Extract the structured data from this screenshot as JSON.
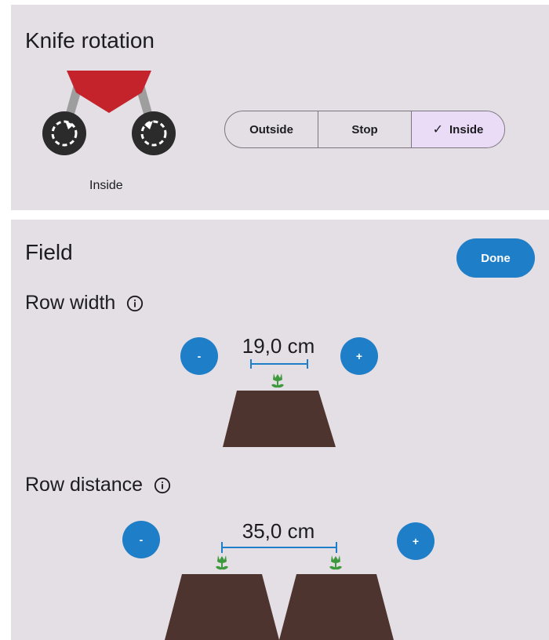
{
  "knife_rotation": {
    "title": "Knife rotation",
    "options": [
      "Outside",
      "Stop",
      "Inside"
    ],
    "selected": "Inside",
    "check_icon": "check-icon",
    "caption": "Inside",
    "colors": {
      "blade": "#c4232b",
      "selected_bg": "#eadcf6"
    }
  },
  "field": {
    "title": "Field",
    "done_label": "Done",
    "row_width": {
      "label": "Row width",
      "info_icon": "info-icon",
      "value": "19,0 cm",
      "minus_label": "-",
      "plus_label": "+"
    },
    "row_distance": {
      "label": "Row distance",
      "info_icon": "info-icon",
      "value": "35,0 cm",
      "minus_label": "-",
      "plus_label": "+"
    },
    "colors": {
      "accent": "#1f7ec8",
      "soil": "#4e342e",
      "plant": "#3c9a3c",
      "card_bg": "#e4dfe4"
    }
  }
}
